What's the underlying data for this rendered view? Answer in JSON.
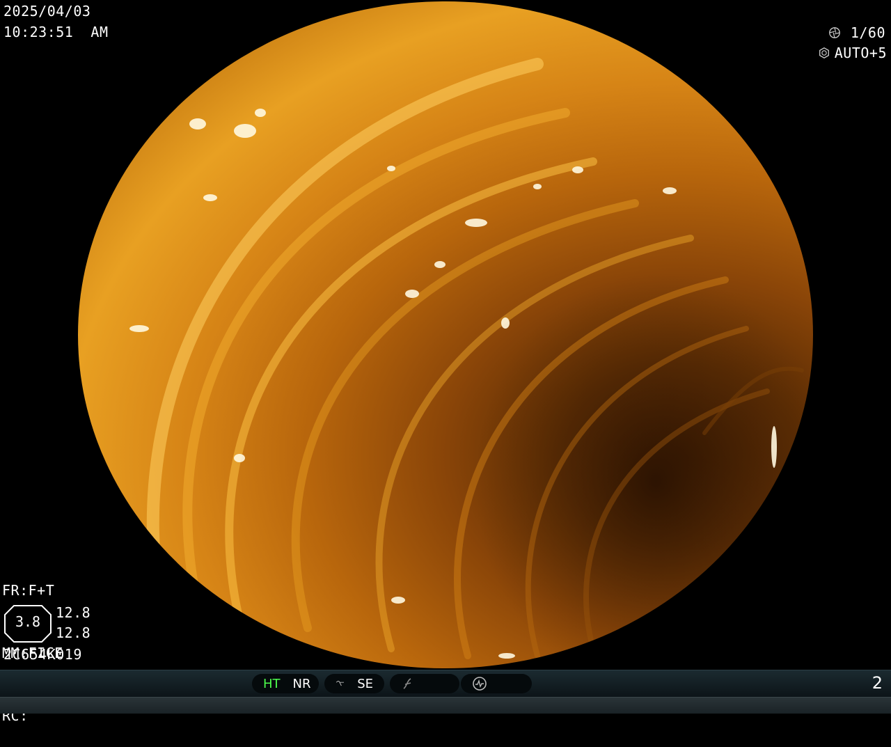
{
  "overlay": {
    "date": "2025/04/03",
    "time": "10:23:51  AM",
    "shutter_speed": "1/60",
    "exposure": "AUTO+5",
    "fr": "FR:F+T",
    "mm": "MM:FICE",
    "rc": "RC:",
    "zoom": "3.8",
    "value_top": "12.8",
    "value_bottom": "12.8",
    "scope_id": "2C654K019"
  },
  "status_bar": {
    "ht": "HT",
    "nr": "NR",
    "se": "SE",
    "page_number": "2"
  },
  "colors": {
    "ht_active": "#4dff4d",
    "scope_orange": "#d68416",
    "bar_bg": "#1b2a30"
  },
  "icons": [
    "shutter-icon",
    "aperture-icon",
    "se-curve-icon",
    "sharpness-icon",
    "gauge-icon"
  ]
}
